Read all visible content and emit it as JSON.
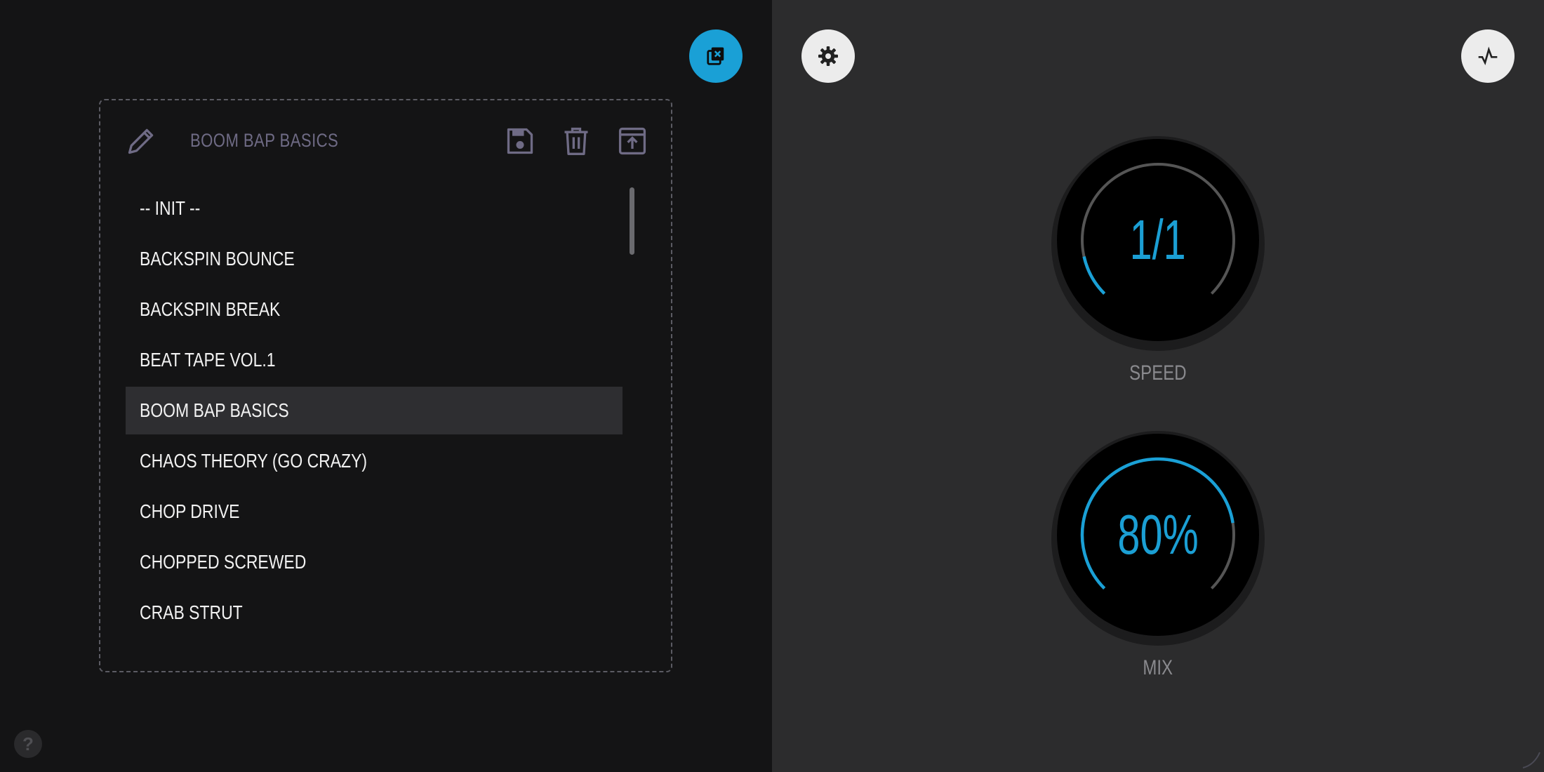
{
  "colors": {
    "accent": "#1aa0d6",
    "knob_track": "#555555",
    "knob_face": "#000000",
    "panel_bg": "#141415",
    "right_bg": "#2c2c2d",
    "dim_text": "#6f6b85"
  },
  "toolbar": {
    "close_presets_icon": "close-library-icon",
    "settings_icon": "gear-icon",
    "activity_icon": "waveform-pulse-icon"
  },
  "preset_panel": {
    "current_preset": "BOOM BAP BASICS",
    "icons": [
      "pencil-icon",
      "floppy-disk-icon",
      "trash-icon",
      "upload-icon"
    ],
    "items": [
      {
        "label": "-- INIT --",
        "selected": false
      },
      {
        "label": "BACKSPIN BOUNCE",
        "selected": false
      },
      {
        "label": "BACKSPIN BREAK",
        "selected": false
      },
      {
        "label": "BEAT TAPE VOL.1",
        "selected": false
      },
      {
        "label": "BOOM BAP BASICS",
        "selected": true
      },
      {
        "label": "CHAOS THEORY (GO CRAZY)",
        "selected": false
      },
      {
        "label": "CHOP DRIVE",
        "selected": false
      },
      {
        "label": "CHOPPED SCREWED",
        "selected": false
      },
      {
        "label": "CRAB STRUT",
        "selected": false
      }
    ]
  },
  "knobs": {
    "speed": {
      "label": "SPEED",
      "value": "1/1",
      "fraction": 0.12
    },
    "mix": {
      "label": "MIX",
      "value": "80%",
      "fraction": 0.8
    }
  },
  "help": {
    "label": "?"
  }
}
